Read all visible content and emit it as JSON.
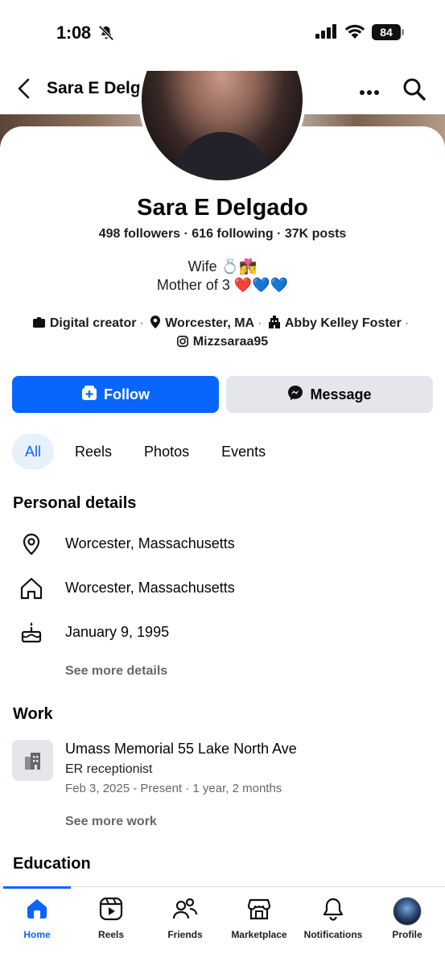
{
  "status_bar": {
    "time": "1:08",
    "battery": "84"
  },
  "header": {
    "title": "Sara E Delgado"
  },
  "profile": {
    "name": "Sara E Delgado",
    "stats": "498 followers · 616 following · 37K posts",
    "bio_line1": "Wife 💍👩‍❤️‍💋‍👨",
    "bio_line2": "Mother of 3 ❤️💙💙",
    "category": "Digital creator",
    "location": "Worcester, MA",
    "school": "Abby Kelley Foster",
    "instagram": "Mizzsaraa95"
  },
  "actions": {
    "follow_label": "Follow",
    "message_label": "Message"
  },
  "tabs": [
    {
      "label": "All",
      "active": true
    },
    {
      "label": "Reels"
    },
    {
      "label": "Photos"
    },
    {
      "label": "Events"
    }
  ],
  "personal_details": {
    "title": "Personal details",
    "current_city": "Worcester, Massachusetts",
    "hometown": "Worcester, Massachusetts",
    "birthday": "January 9, 1995",
    "see_more": "See more details"
  },
  "work": {
    "title": "Work",
    "employer": "Umass Memorial 55 Lake North Ave",
    "role": "ER receptionist",
    "dates": "Feb 3, 2025 - Present · 1 year, 2 months",
    "see_more": "See more work"
  },
  "education": {
    "title": "Education"
  },
  "bottom_nav": [
    {
      "label": "Home",
      "icon": "home-icon",
      "active": true
    },
    {
      "label": "Reels",
      "icon": "reels-icon"
    },
    {
      "label": "Friends",
      "icon": "friends-icon"
    },
    {
      "label": "Marketplace",
      "icon": "marketplace-icon"
    },
    {
      "label": "Notifications",
      "icon": "bell-icon"
    },
    {
      "label": "Profile",
      "icon": "profile-avatar"
    }
  ],
  "colors": {
    "accent": "#0866ff",
    "secondary_button": "#e4e6eb",
    "muted_text": "#65676b"
  }
}
